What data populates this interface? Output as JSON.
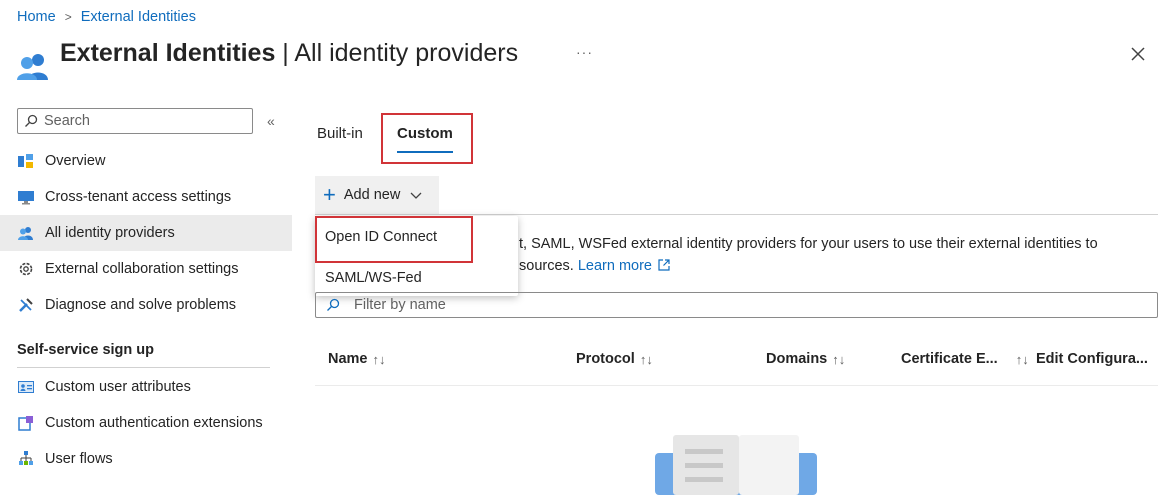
{
  "breadcrumb": {
    "home": "Home",
    "current": "External Identities"
  },
  "header": {
    "title_bold": "External Identities",
    "title_rest": " | All identity providers",
    "more": "···",
    "close_icon": "close-icon"
  },
  "sidebar": {
    "search_placeholder": "Search",
    "collapse": "«",
    "items": [
      {
        "label": "Overview",
        "icon": "overview-icon"
      },
      {
        "label": "Cross-tenant access settings",
        "icon": "monitor-icon"
      },
      {
        "label": "All identity providers",
        "icon": "users-icon",
        "active": true
      },
      {
        "label": "External collaboration settings",
        "icon": "gear-icon"
      },
      {
        "label": "Diagnose and solve problems",
        "icon": "wrench-icon"
      }
    ],
    "section_title": "Self-service sign up",
    "section_items": [
      {
        "label": "Custom user attributes",
        "icon": "user-attributes-icon"
      },
      {
        "label": "Custom authentication extensions",
        "icon": "extension-icon"
      },
      {
        "label": "User flows",
        "icon": "flow-icon"
      }
    ]
  },
  "tabs": [
    {
      "label": "Built-in"
    },
    {
      "label": "Custom",
      "selected": true
    }
  ],
  "toolbar": {
    "add_new": "Add new"
  },
  "dropdown": {
    "items": [
      "Open ID Connect",
      "SAML/WS-Fed"
    ]
  },
  "description": {
    "line1": "t, SAML, WSFed external identity providers for your users to use their external identities to",
    "line2_prefix": "sources. ",
    "learn_more": "Learn more"
  },
  "filter": {
    "placeholder": "Filter by name"
  },
  "table": {
    "columns": [
      "Name",
      "Protocol",
      "Domains",
      "Certificate E...",
      "Edit Configura..."
    ],
    "sort_glyph": "↑↓"
  },
  "colors": {
    "accent": "#0f6cbd",
    "highlight": "#d13438"
  }
}
